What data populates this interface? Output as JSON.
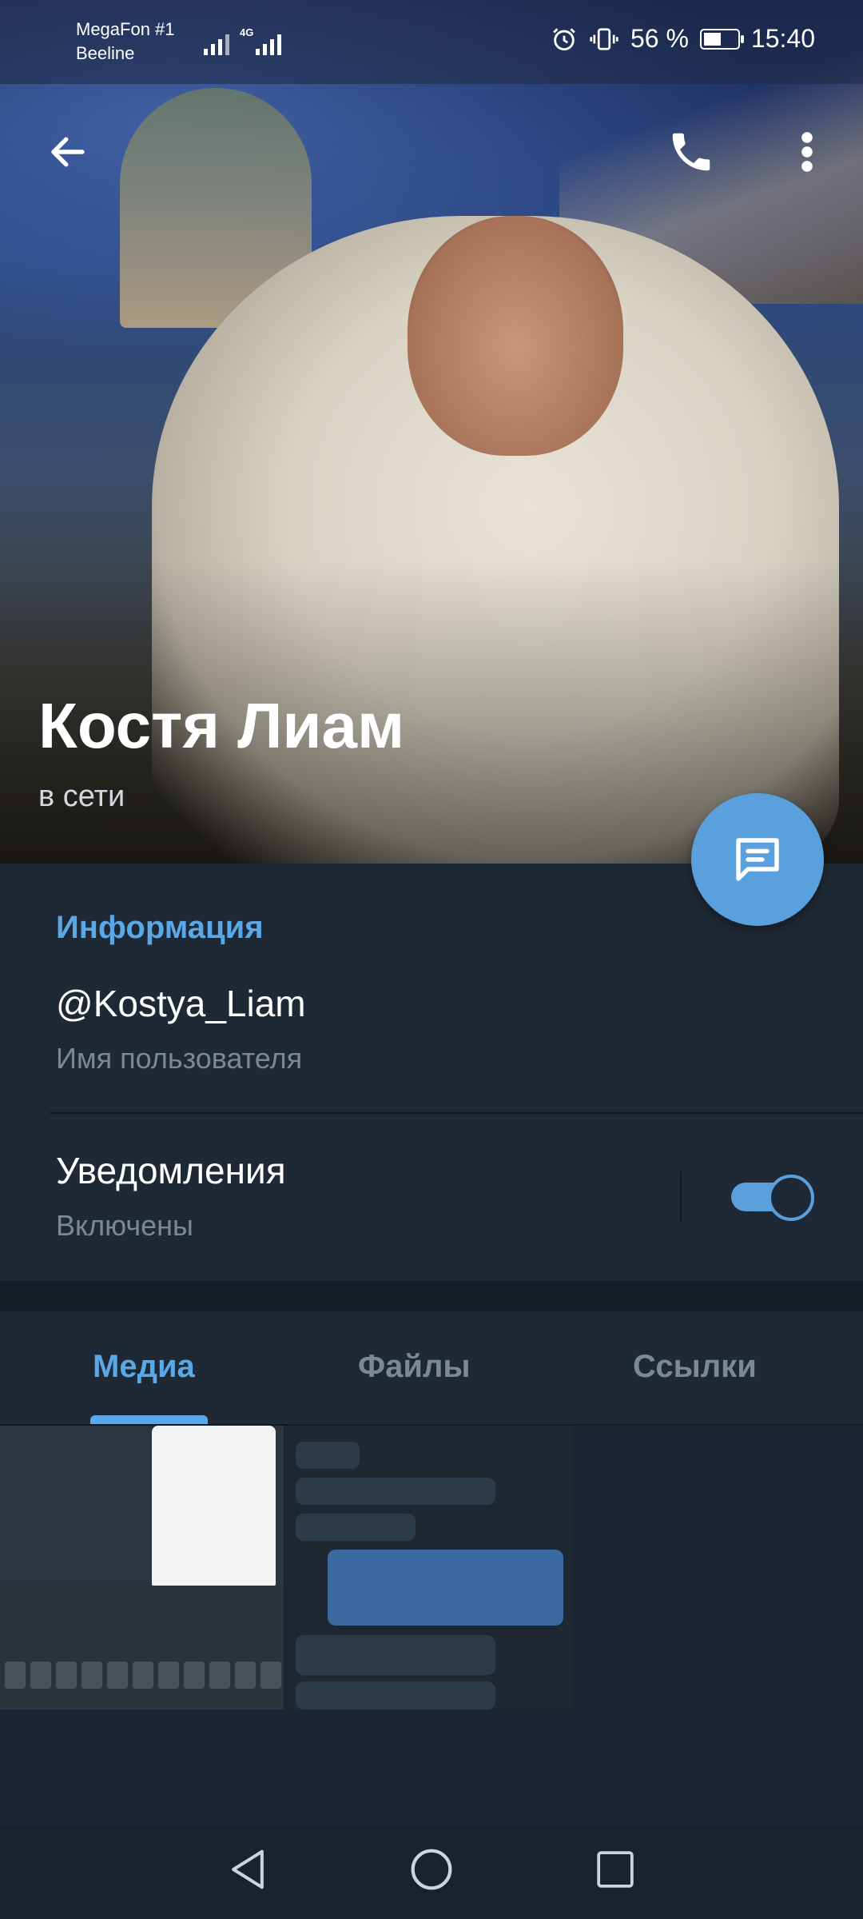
{
  "status_bar": {
    "carrier_1": "MegaFon #1",
    "carrier_2": "Beeline",
    "network_type": "4G",
    "battery_percent": "56 %",
    "battery_level": 0.56,
    "time": "15:40",
    "icons": [
      "signal-icon",
      "alarm-icon",
      "vibrate-icon",
      "battery-icon"
    ]
  },
  "header": {
    "back_icon": "back-arrow-icon",
    "call_icon": "phone-icon",
    "menu_icon": "more-vert-icon"
  },
  "profile": {
    "name": "Костя Лиам",
    "presence": "в сети",
    "fab_icon": "message-icon"
  },
  "info": {
    "section_title": "Информация",
    "username": "@Kostya_Liam",
    "username_label": "Имя пользователя",
    "notifications_title": "Уведомления",
    "notifications_state": "Включены",
    "notifications_enabled": true
  },
  "tabs": {
    "items": [
      {
        "label": "Медиа",
        "active": true
      },
      {
        "label": "Файлы",
        "active": false
      },
      {
        "label": "Ссылки",
        "active": false
      }
    ]
  },
  "colors": {
    "accent": "#5aa8e6",
    "background": "#1b2533",
    "surface": "#1f2936",
    "muted_text": "#7d8895"
  },
  "nav": {
    "icons": [
      "nav-back-icon",
      "nav-home-icon",
      "nav-recents-icon"
    ]
  }
}
